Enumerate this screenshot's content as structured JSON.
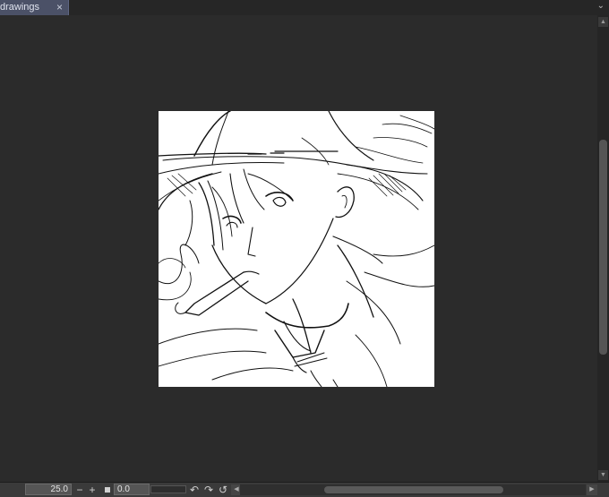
{
  "tab": {
    "title": "drawings",
    "close_glyph": "×"
  },
  "tab_menu_glyph": "⌄",
  "status": {
    "zoom": "25.0",
    "rotation": "0.0",
    "zoom_out_glyph": "−",
    "zoom_in_glyph": "+",
    "undo_glyph": "↶",
    "redo_glyph": "↷",
    "reset_glyph": "↺"
  },
  "colors": {
    "background": "#2b2b2b",
    "tab_active": "#4b5167",
    "canvas": "#ffffff"
  },
  "icons": [
    "close-icon",
    "chevron-down-icon",
    "zoom-out-icon",
    "zoom-in-icon",
    "fit-icon",
    "rotate-left-icon",
    "rotate-right-icon",
    "reset-rotation-icon"
  ]
}
